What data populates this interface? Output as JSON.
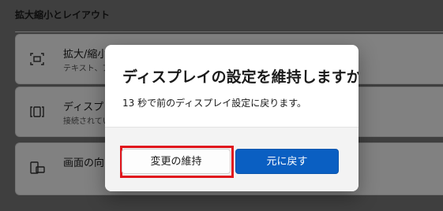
{
  "settings": {
    "section_title": "拡大縮小とレイアウト",
    "rows": [
      {
        "title": "拡大/縮小",
        "subtitle": "テキスト、ア",
        "icon": "scale-icon"
      },
      {
        "title": "ディスプレイ",
        "subtitle": "接続されてい",
        "icon": "display-resolution-icon"
      },
      {
        "title": "画面の向",
        "subtitle": "",
        "icon": "orientation-icon"
      }
    ]
  },
  "dialog": {
    "title": "ディスプレイの設定を維持しますか?",
    "message": "13 秒で前のディスプレイ設定に戻ります。",
    "keep_label": "変更の維持",
    "revert_label": "元に戻す"
  },
  "colors": {
    "accent": "#0a5fc2",
    "highlight": "#e0151c"
  }
}
